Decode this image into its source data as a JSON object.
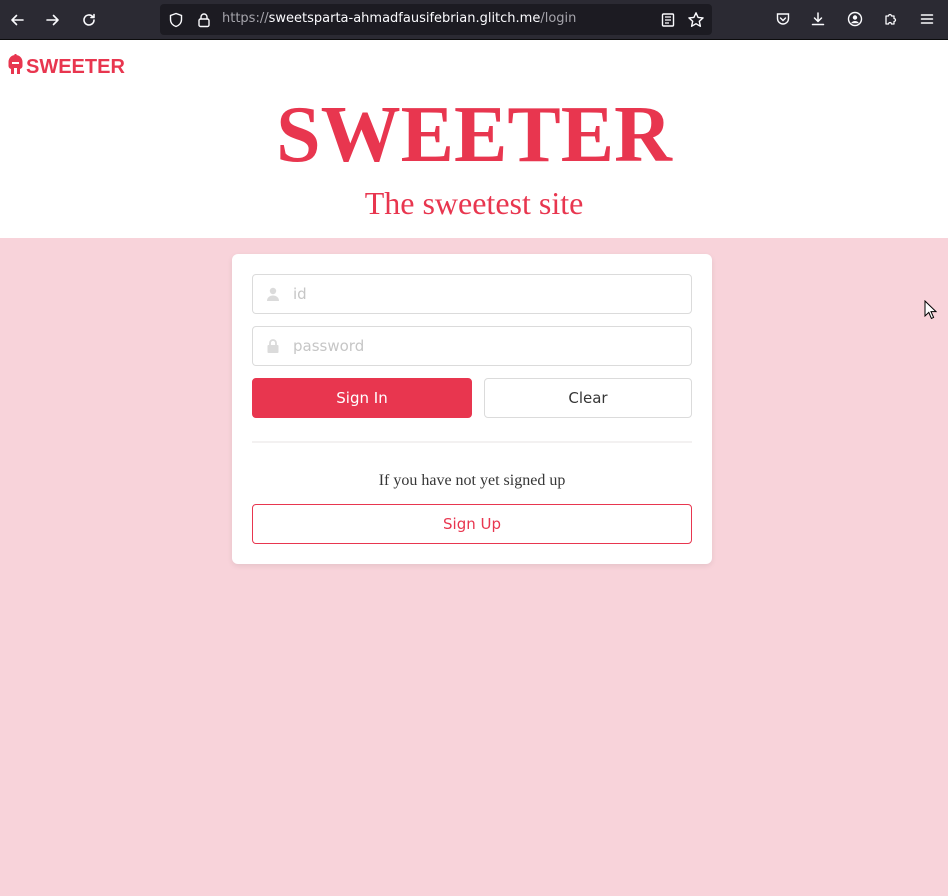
{
  "browser": {
    "url_prefix": "https://",
    "url_host": "sweetsparta-ahmadfausifebrian.glitch.me",
    "url_path": "/login",
    "icons": [
      "back-icon",
      "forward-icon",
      "reload-icon",
      "shield-icon",
      "lock-icon",
      "reader-mode-icon",
      "bookmark-star-icon",
      "pocket-icon",
      "download-icon",
      "account-icon",
      "extensions-icon",
      "menu-icon"
    ]
  },
  "header": {
    "logo_text": "SWEETER",
    "title": "SWEETER",
    "subtitle": "The sweetest site"
  },
  "login": {
    "id_placeholder": "id",
    "password_placeholder": "password",
    "signin_label": "Sign In",
    "clear_label": "Clear",
    "hint": "If you have not yet signed up",
    "signup_label": "Sign Up"
  },
  "colors": {
    "accent": "#e8364f",
    "page_bg": "#f8d3da",
    "chrome_bg": "#2b2a33"
  }
}
